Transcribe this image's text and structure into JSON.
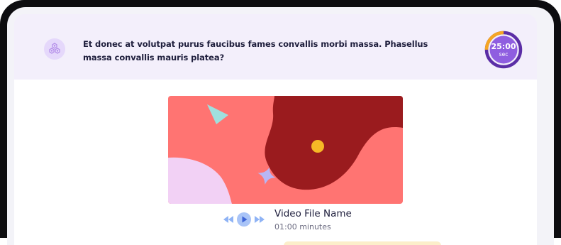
{
  "question": {
    "text": "Et donec at volutpat purus faucibus fames convallis morbi massa. Phasellus massa convallis mauris platea?",
    "icon": "hexagon-cluster-icon"
  },
  "timer": {
    "value": "25:00",
    "unit": "sec",
    "progress_fraction": 0.75,
    "ring_color": "#5b2ea6",
    "progress_color": "#f5a623",
    "center_color": "#8f5ee0"
  },
  "video": {
    "title": "Video File Name",
    "duration": "01:00 minutes",
    "controls": {
      "rewind_icon": "rewind-icon",
      "play_icon": "play-icon",
      "forward_icon": "fast-forward-icon"
    },
    "thumbnail_colors": {
      "background": "#ff7472",
      "dark_shape": "#9a1b1e",
      "triangle": "#9fe0de",
      "star": "#b8b6f5",
      "circle_bottom": "#f2d1f5",
      "dot": "#f6b826"
    }
  }
}
